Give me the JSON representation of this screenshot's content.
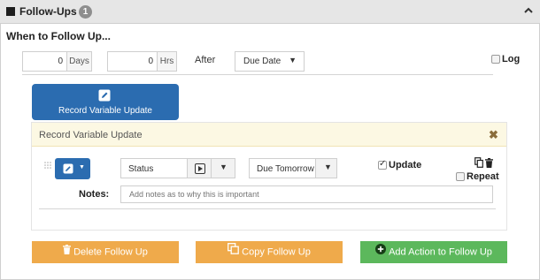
{
  "header": {
    "title": "Follow-Ups",
    "badge": "1"
  },
  "when": {
    "title": "When to Follow Up...",
    "days_value": "0",
    "days_label": "Days",
    "hrs_value": "0",
    "hrs_label": "Hrs",
    "after_label": "After",
    "after_select": "Due Date",
    "log_label": "Log",
    "log_checked": false
  },
  "action_button": {
    "label": "Record Variable Update"
  },
  "card": {
    "title": "Record Variable Update",
    "status_value": "Status",
    "due_value": "Due Tomorrow",
    "update_label": "Update",
    "update_checked": true,
    "repeat_label": "Repeat",
    "repeat_checked": false,
    "notes_label": "Notes:",
    "notes_placeholder": "Add notes as to why this is important"
  },
  "footer": {
    "delete_label": "Delete Follow Up",
    "copy_label": "Copy Follow Up",
    "add_label": "Add Action to Follow Up"
  },
  "colors": {
    "primary_blue": "#2b6cb0",
    "orange": "#efaa4b",
    "green": "#5cb85c",
    "card_header_bg": "#fcf8e3",
    "panel_header_bg": "#e6e6e6"
  },
  "icons": [
    "square-icon",
    "chevron-up-icon",
    "pencil-icon",
    "close-icon",
    "drag-handle-icon",
    "play-icon",
    "caret-down-icon",
    "copy-icon",
    "trash-icon",
    "plus-circle-icon"
  ]
}
